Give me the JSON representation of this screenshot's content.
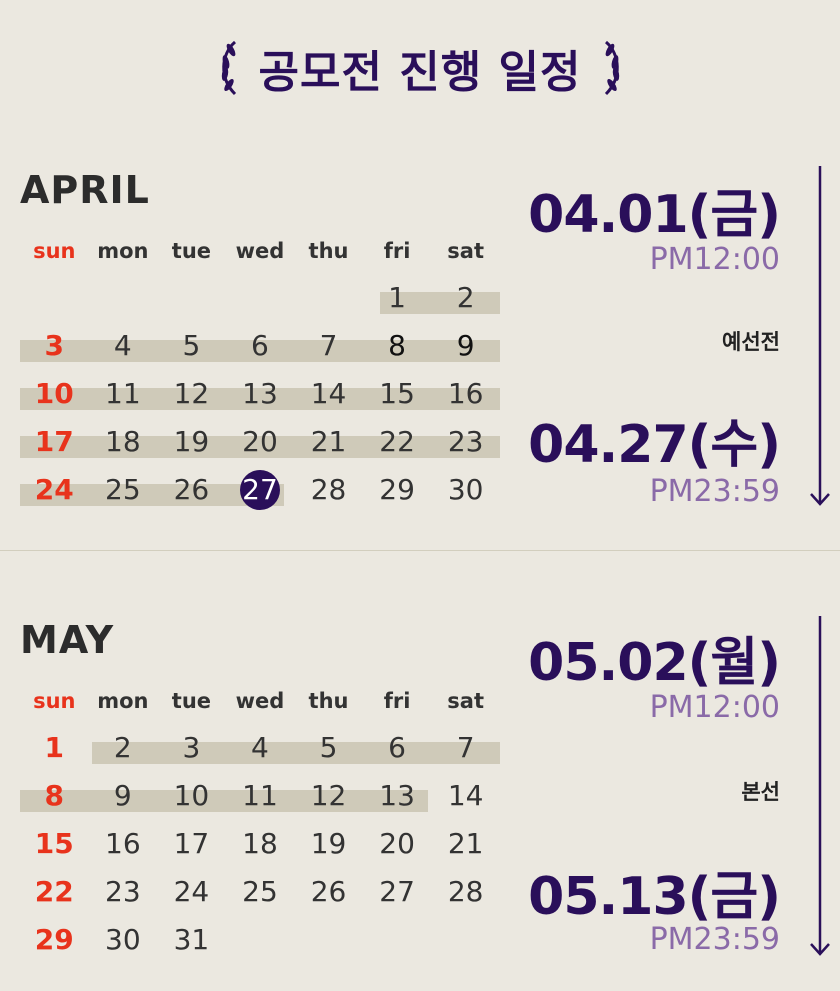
{
  "title": "공모전 진행 일정",
  "weekday_labels": [
    "sun",
    "mon",
    "tue",
    "wed",
    "thu",
    "fri",
    "sat"
  ],
  "april": {
    "name": "APRIL",
    "stage": "예선전",
    "start": {
      "date": "04.01(금)",
      "time": "PM12:00"
    },
    "end": {
      "date": "04.27(수)",
      "time": "PM23:59"
    },
    "weeks": [
      [
        "",
        "",
        "",
        "",
        "",
        "1",
        "2"
      ],
      [
        "3",
        "4",
        "5",
        "6",
        "7",
        "8",
        "9"
      ],
      [
        "10",
        "11",
        "12",
        "13",
        "14",
        "15",
        "16"
      ],
      [
        "17",
        "18",
        "19",
        "20",
        "21",
        "22",
        "23"
      ],
      [
        "24",
        "25",
        "26",
        "27",
        "28",
        "29",
        "30"
      ]
    ]
  },
  "may": {
    "name": "MAY",
    "stage": "본선",
    "start": {
      "date": "05.02(월)",
      "time": "PM12:00"
    },
    "end": {
      "date": "05.13(금)",
      "time": "PM23:59"
    },
    "weeks": [
      [
        "1",
        "2",
        "3",
        "4",
        "5",
        "6",
        "7"
      ],
      [
        "8",
        "9",
        "10",
        "11",
        "12",
        "13",
        "14"
      ],
      [
        "15",
        "16",
        "17",
        "18",
        "19",
        "20",
        "21"
      ],
      [
        "22",
        "23",
        "24",
        "25",
        "26",
        "27",
        "28"
      ],
      [
        "29",
        "30",
        "31",
        "",
        "",
        "",
        ""
      ]
    ]
  },
  "colors": {
    "accent": "#2a0f5a",
    "sunday": "#e8331c",
    "time": "#8a6aa8",
    "highlight": "#cfcab9",
    "background": "#ebe8e0"
  },
  "icons": [
    "laurel-left-icon",
    "laurel-right-icon",
    "arrow-down-icon"
  ]
}
